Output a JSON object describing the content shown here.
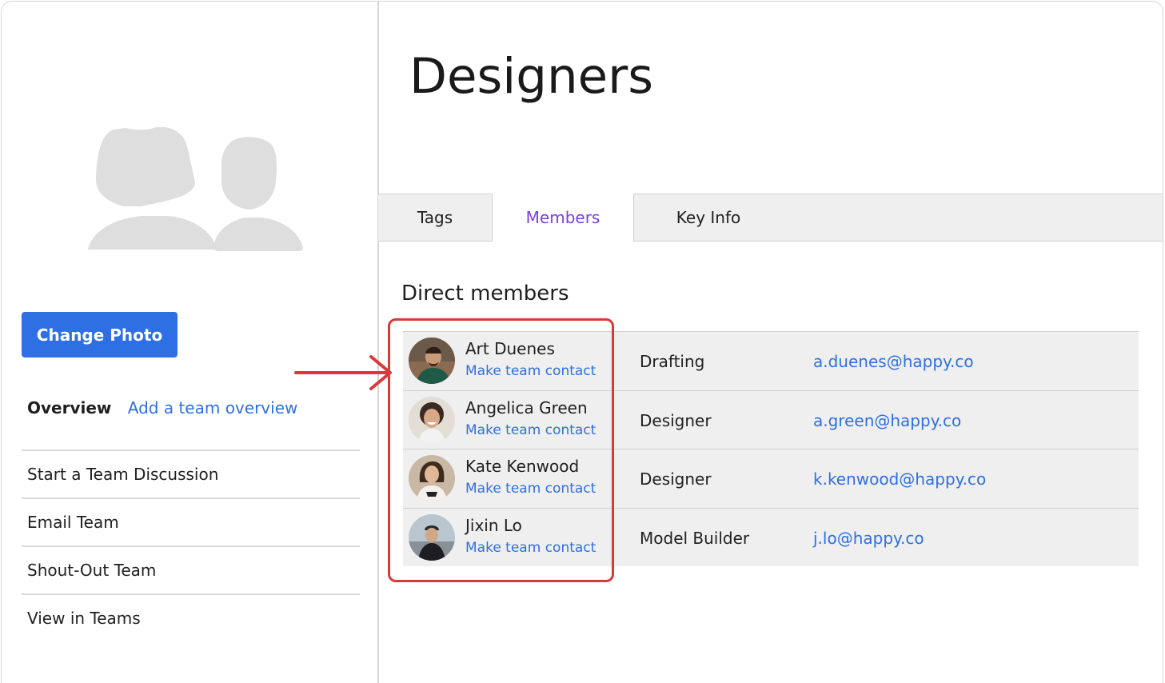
{
  "team": {
    "title": "Designers"
  },
  "left_panel": {
    "change_photo_label": "Change Photo",
    "overview_label": "Overview",
    "overview_link": "Add a team overview",
    "actions": [
      {
        "label": "Start a Team Discussion"
      },
      {
        "label": "Email Team"
      },
      {
        "label": "Shout-Out Team"
      },
      {
        "label": "View in Teams"
      }
    ]
  },
  "tabs": [
    {
      "label": "Tags",
      "active": false
    },
    {
      "label": "Members",
      "active": true
    },
    {
      "label": "Key Info",
      "active": false
    }
  ],
  "members_section": {
    "title": "Direct members",
    "members": [
      {
        "name": "Art Duenes",
        "action": "Make team contact",
        "role": "Drafting",
        "email": "a.duenes@happy.co"
      },
      {
        "name": "Angelica Green",
        "action": "Make team contact",
        "role": "Designer",
        "email": "a.green@happy.co"
      },
      {
        "name": "Kate Kenwood",
        "action": "Make team contact",
        "role": "Designer",
        "email": "k.kenwood@happy.co"
      },
      {
        "name": "Jixin Lo",
        "action": "Make team contact",
        "role": "Model Builder",
        "email": "j.lo@happy.co"
      }
    ]
  },
  "colors": {
    "accent_blue": "#2f6fe4",
    "active_tab": "#7b3fe4",
    "annotation_red": "#d83a3a"
  }
}
